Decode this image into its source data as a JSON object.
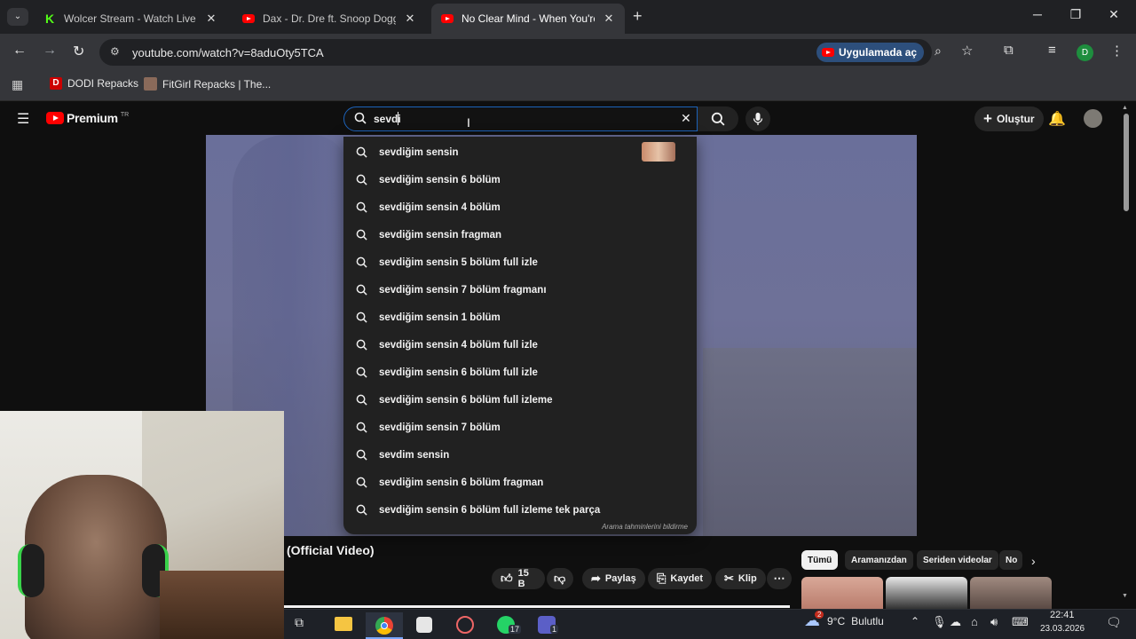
{
  "browser": {
    "tabs": [
      {
        "title": "Wolcer Stream - Watch Live on",
        "favicon": "kick-icon",
        "active": false
      },
      {
        "title": "Dax - Dr. Dre ft. Snoop Dogg \"S",
        "favicon": "youtube-icon",
        "active": false
      },
      {
        "title": "No Clear Mind - When You're N",
        "favicon": "youtube-icon",
        "active": true
      }
    ],
    "new_tab": "+",
    "url": "youtube.com/watch?v=8aduOty5TCA",
    "open_in_app": "Uygulamada aç",
    "profile_initial": "D",
    "bookmarks": [
      {
        "label": "DODI Repacks"
      },
      {
        "label": "FitGirl Repacks | The..."
      }
    ]
  },
  "youtube": {
    "logo_text": "Premium",
    "logo_region": "TR",
    "search_value": "sevdi",
    "create_label": "Oluştur",
    "suggestions": [
      "sevdiğim sensin",
      "sevdiğim sensin 6 bölüm",
      "sevdiğim sensin 4 bölüm",
      "sevdiğim sensin fragman",
      "sevdiğim sensin 5 bölüm full izle",
      "sevdiğim sensin 7 bölüm fragmanı",
      "sevdiğim sensin 1 bölüm",
      "sevdiğim sensin 4 bölüm full izle",
      "sevdiğim sensin 6 bölüm full izle",
      "sevdiğim sensin 6 bölüm full izleme",
      "sevdiğim sensin 7 bölüm",
      "sevdim sensin",
      "sevdiğim sensin 6 bölüm fragman",
      "sevdiğim sensin 6 bölüm full izleme tek parça"
    ],
    "report_predictions": "Arama tahminlerini bildirme",
    "video_title_visible": "(Official Video)",
    "actions": {
      "like_count": "15 B",
      "share": "Paylaş",
      "save": "Kaydet",
      "clip": "Klip"
    },
    "chips": [
      "Tümü",
      "Aramanızdan",
      "Seriden videolar",
      "No"
    ]
  },
  "taskbar": {
    "whatsapp_badge": "17",
    "teams_badge": "1",
    "weather_temp": "9°C",
    "weather_desc": "Bulutlu",
    "weather_badge": "2",
    "time": "22:41",
    "date": "23.03.2026"
  },
  "colors": {
    "yt_red": "#ff0000",
    "search_border": "#1c62b9",
    "app_open_bg": "#2d4f7c"
  }
}
